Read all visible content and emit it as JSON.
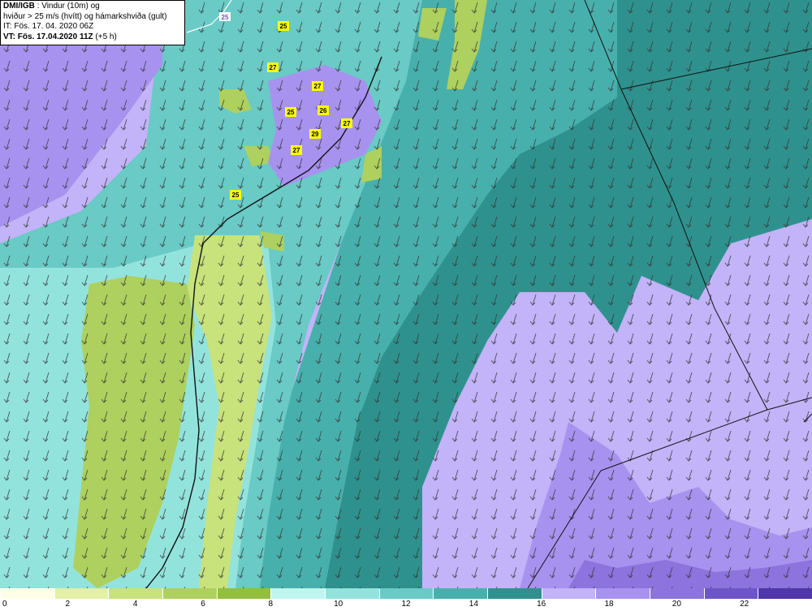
{
  "header": {
    "line1_bold": "DMI/IGB",
    "line1_rest": " : Vindur (10m) og",
    "line2": "hviður > 25 m/s (hvítt) og hámarkshviða (gult)",
    "line3": "IT: Fös. 17. 04. 2020 06Z",
    "line4_bold": "VT: Fös. 17.04.2020 11Z",
    "line4_rest": " (+5 h)"
  },
  "gust_markers": [
    "25",
    "27",
    "27",
    "26",
    "25",
    "27",
    "29",
    "27",
    "25"
  ],
  "white_contour_label": "25",
  "colorbar": {
    "colors": [
      "#ffffe8",
      "#e3f0a6",
      "#c8e27c",
      "#aed05e",
      "#92bf3e",
      "#bff5ee",
      "#93e3dd",
      "#69cac6",
      "#48b0ac",
      "#2f918d",
      "#c3b3f8",
      "#a892ef",
      "#8c73dd",
      "#6d55c8",
      "#4f36a9"
    ],
    "tick_labels": [
      "0",
      "2",
      "4",
      "6",
      "8",
      "10",
      "12",
      "14",
      "16",
      "18",
      "20",
      "22"
    ]
  }
}
